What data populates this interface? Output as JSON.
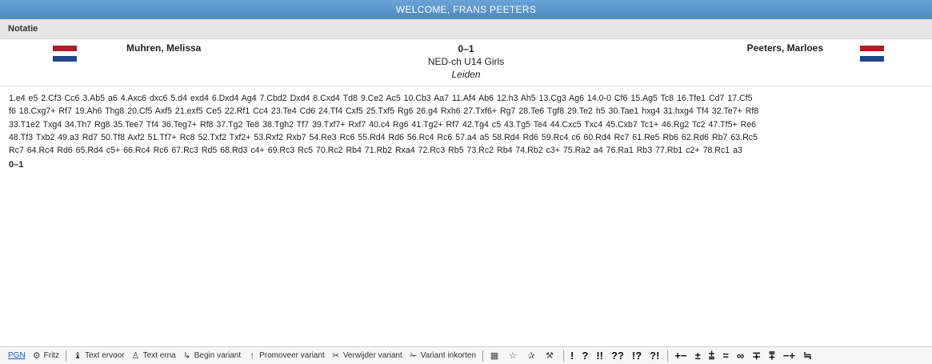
{
  "title": "WELCOME, FRANS PEETERS",
  "section": "Notatie",
  "game": {
    "white": "Muhren, Melissa",
    "black": "Peeters, Marloes",
    "result": "0–1",
    "event": "NED-ch U14 Girls",
    "site": "Leiden",
    "white_flag": "Netherlands",
    "black_flag": "Netherlands"
  },
  "moves_lines": [
    "1.e4  e5  2.Cf3  Cc6  3.Ab5  a6  4.Axc6  dxc6  5.d4  exd4  6.Dxd4  Ag4  7.Cbd2  Dxd4  8.Cxd4  Td8  9.Ce2  Ac5  10.Cb3  Aa7  11.Af4  Ab6  12.h3  Ah5  13.Cg3  Ag6  14.0-0  Cf6  15.Ag5  Tc8  16.Tfe1  Cd7  17.Cf5",
    "f6  18.Cxg7+  Rf7  19.Ah6  Thg8  20.Cf5  Axf5  21.exf5  Ce5  22.Rf1  Cc4  23.Te4  Cd6  24.Tf4  Cxf5  25.Txf5  Rg6  26.g4  Rxh6  27.Txf6+  Rg7  28.Te6  Tgf8  29.Te2  h5  30.Tae1  hxg4  31.hxg4  Tf4  32.Te7+  Rf8",
    "33.T1e2  Txg4  34.Th7  Rg8  35.Tee7  Tf4  36.Teg7+  Rf8  37.Tg2  Te8  38.Tgh2  Tf7  39.Txf7+  Rxf7  40.c4  Rg6  41.Tg2+  Rf7  42.Tg4  c5  43.Tg5  Te4  44.Cxc5  Txc4  45.Cxb7  Tc1+  46.Rg2  Tc2  47.Tf5+  Re6",
    "48.Tf3  Txb2  49.a3  Rd7  50.Tf8  Axf2  51.Tf7+  Rc8  52.Txf2  Txf2+  53.Rxf2  Rxb7  54.Re3  Rc6  55.Rd4  Rd6  56.Rc4  Rc6  57.a4  a5  58.Rd4  Rd6  59.Rc4  c6  60.Rd4  Rc7  61.Re5  Rb6  62.Rd6  Rb7  63.Rc5",
    "Rc7  64.Rc4  Rd6  65.Rd4  c5+  66.Rc4  Rc6  67.Rc3  Rd5  68.Rd3  c4+  69.Rc3  Rc5  70.Rc2  Rb4  71.Rb2  Rxa4  72.Rc3  Rb5  73.Rc2  Rb4  74.Rb2  c3+  75.Ra2  a4  76.Ra1  Rb3  77.Rb1  c2+  78.Rc1  a3"
  ],
  "final_result": "0–1",
  "toolbar": {
    "pgn": "PGN",
    "fritz": "Fritz",
    "text_before": "Text ervoor",
    "text_after": "Text erna",
    "begin_variant": "Begin variant",
    "promote_variant": "Promoveer variant",
    "delete_variant": "Verwijder variant",
    "shorten_variant": "Variant inkorten",
    "symbols": [
      "!",
      "?",
      "!!",
      "??",
      "!?",
      "?!",
      "+−",
      "±",
      "⩲",
      "=",
      "∞",
      "∓",
      "⩱",
      "−+",
      "≒"
    ]
  }
}
